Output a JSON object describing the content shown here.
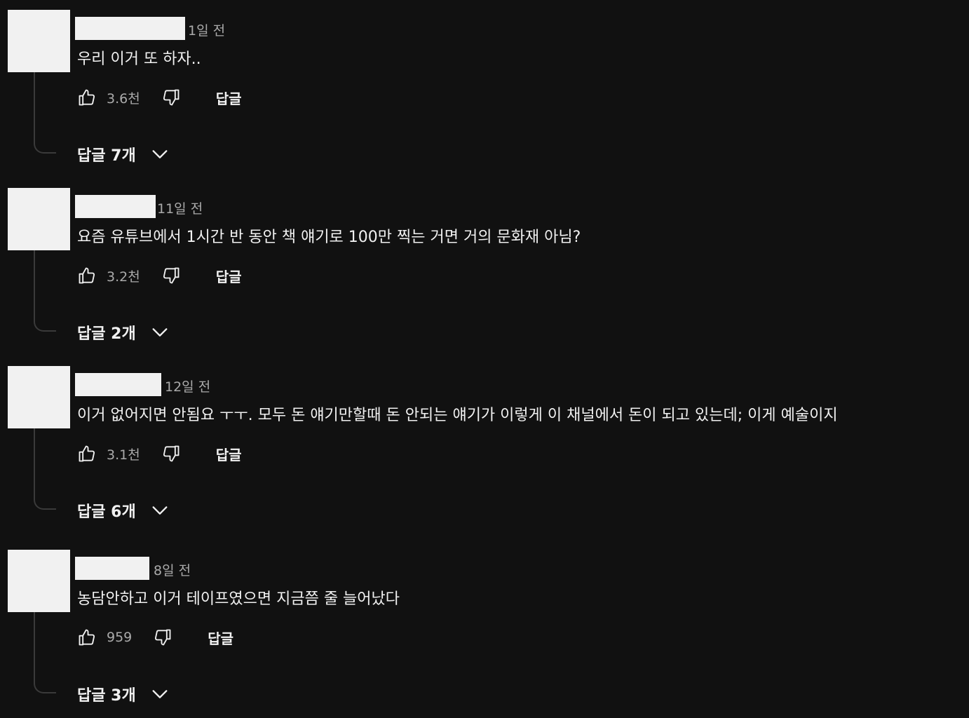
{
  "comments": [
    {
      "time": "1일 전",
      "text": "우리 이거 또 하자..",
      "likes": "3.6천",
      "reply_label": "답글",
      "replies_label": "답글 7개"
    },
    {
      "time": "11일 전",
      "text": "요즘 유튜브에서 1시간 반 동안 책 얘기로 100만 찍는 거면 거의 문화재 아님?",
      "likes": "3.2천",
      "reply_label": "답글",
      "replies_label": "답글 2개"
    },
    {
      "time": "12일 전",
      "text": "이거 없어지면 안됨요 ㅜㅜ. 모두 돈 얘기만할때 돈 안되는 얘기가 이렇게 이 채널에서 돈이 되고 있는데; 이게 예술이지",
      "likes": "3.1천",
      "reply_label": "답글",
      "replies_label": "답글 6개"
    },
    {
      "time": "8일 전",
      "text": "농담안하고 이거 테이프였으면 지금쯤 줄 늘어났다",
      "likes": "959",
      "reply_label": "답글",
      "replies_label": "답글 3개"
    }
  ],
  "icons": {
    "like": "thumbs-up-icon",
    "dislike": "thumbs-down-icon",
    "expand": "chevron-down-icon"
  },
  "colors": {
    "background": "#111111",
    "text": "#f1f1f1",
    "secondary_text": "#aaaaaa",
    "redaction": "#f1f1f1"
  }
}
